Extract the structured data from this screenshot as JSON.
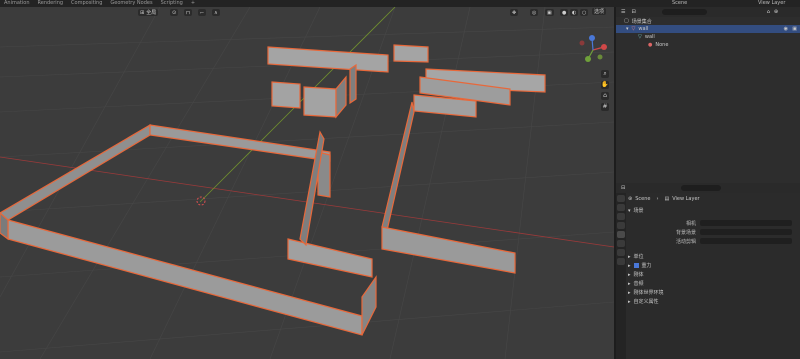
{
  "topbar": {
    "workspaces": [
      "Animation",
      "Rendering",
      "Compositing",
      "Geometry Nodes",
      "Scripting"
    ],
    "add_tab": "+",
    "scene": "Scene",
    "view_layer": "View Layer"
  },
  "viewport": {
    "mode_label": "全局",
    "options_label": "选项"
  },
  "outliner": {
    "rows": [
      {
        "label": "场景集合"
      },
      {
        "label": "wall"
      },
      {
        "label": "wall"
      },
      {
        "label": "None"
      }
    ]
  },
  "properties": {
    "scene_label": "Scene",
    "view_layer_label": "View Layer",
    "section_scene": "场景",
    "camera_label": "相机",
    "background_scene_label": "背景场景",
    "active_clip_label": "活动剪辑",
    "sections": [
      "单位",
      "重力",
      "刚体",
      "音频",
      "刚体世界环境",
      "自定义属性"
    ]
  },
  "colors": {
    "selection_outline": "#e8683a",
    "viewport_bg": "#3c3c3c",
    "x_axis": "#9c3a3a",
    "y_axis": "#6f8f2e",
    "outliner_selected": "#334d80"
  }
}
